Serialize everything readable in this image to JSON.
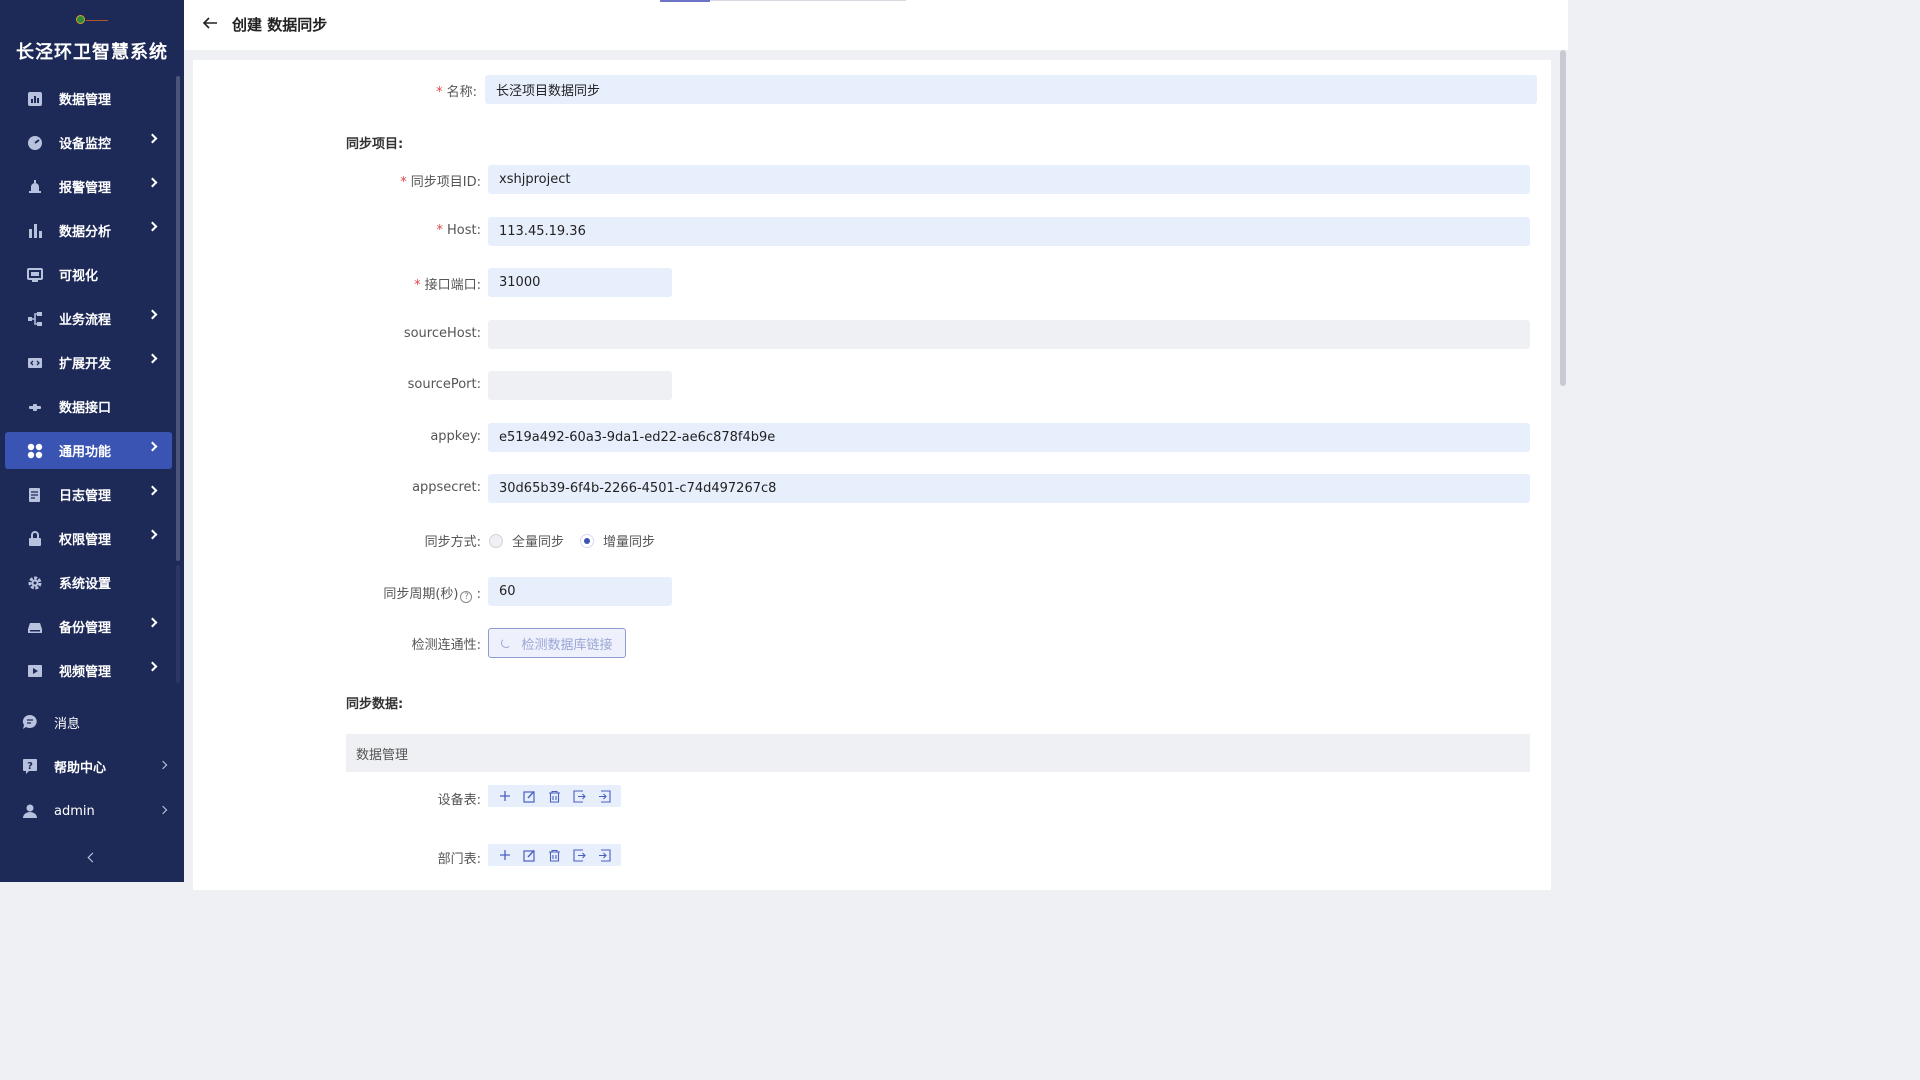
{
  "app": {
    "title": "长泾环卫智慧系统"
  },
  "sidebar": {
    "items": [
      {
        "label": "数据管理",
        "icon": "bar-chart-icon",
        "has_children": false
      },
      {
        "label": "设备监控",
        "icon": "monitor-gauge-icon",
        "has_children": true
      },
      {
        "label": "报警管理",
        "icon": "alarm-icon",
        "has_children": true
      },
      {
        "label": "数据分析",
        "icon": "column-chart-icon",
        "has_children": true
      },
      {
        "label": "可视化",
        "icon": "screen-icon",
        "has_children": false
      },
      {
        "label": "业务流程",
        "icon": "flow-icon",
        "has_children": true
      },
      {
        "label": "扩展开发",
        "icon": "code-icon",
        "has_children": true
      },
      {
        "label": "数据接口",
        "icon": "plug-icon",
        "has_children": false
      },
      {
        "label": "通用功能",
        "icon": "grid-icon",
        "has_children": true,
        "active": true
      },
      {
        "label": "日志管理",
        "icon": "log-icon",
        "has_children": true
      },
      {
        "label": "权限管理",
        "icon": "lock-icon",
        "has_children": true
      },
      {
        "label": "系统设置",
        "icon": "gear-icon",
        "has_children": false
      },
      {
        "label": "备份管理",
        "icon": "backup-icon",
        "has_children": true
      },
      {
        "label": "视频管理",
        "icon": "video-icon",
        "has_children": true
      }
    ],
    "bottom": {
      "messages": "消息",
      "help": "帮助中心",
      "user": "admin"
    }
  },
  "header": {
    "title": "创建 数据同步"
  },
  "form": {
    "name_label": "名称",
    "name_value": "长泾项目数据同步",
    "sync_project_section": "同步项目:",
    "project_id_label": "同步项目ID",
    "project_id_value": "xshjproject",
    "host_label": "Host",
    "host_value": "113.45.19.36",
    "port_label": "接口端口",
    "port_value": "31000",
    "source_host_label": "sourceHost",
    "source_host_value": "",
    "source_port_label": "sourcePort",
    "source_port_value": "",
    "appkey_label": "appkey",
    "appkey_value": "e519a492-60a3-9da1-ed22-ae6c878f4b9e",
    "appsecret_label": "appsecret",
    "appsecret_value": "30d65b39-6f4b-2266-4501-c74d497267c8",
    "sync_mode_label": "同步方式",
    "sync_mode_options": [
      "全量同步",
      "增量同步"
    ],
    "sync_mode_selected": "增量同步",
    "sync_period_label": "同步周期(秒)",
    "sync_period_value": "60",
    "connectivity_label": "检测连通性",
    "connectivity_button": "检测数据库链接",
    "sync_data_section": "同步数据:",
    "data_group": "数据管理",
    "device_table_label": "设备表",
    "dept_table_label": "部门表",
    "colon": ":",
    "required_mark": "*"
  },
  "colors": {
    "sidebar_bg": "#1d2a58",
    "active": "#3a54b4",
    "input_bg": "#e8effc",
    "required": "#e14545"
  }
}
